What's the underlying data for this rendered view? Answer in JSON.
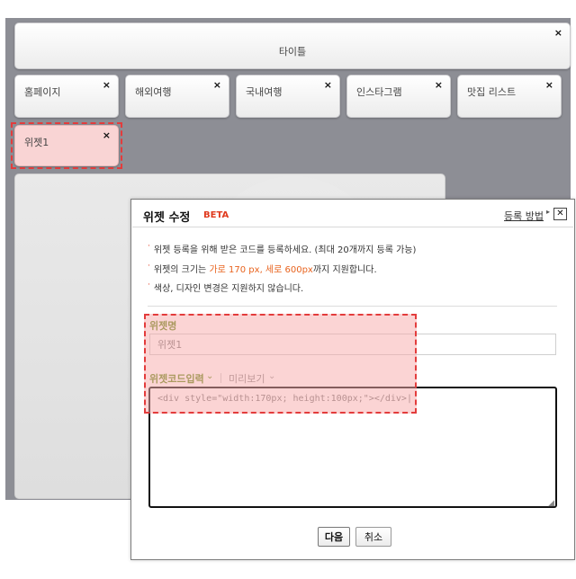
{
  "editor": {
    "title_tile": {
      "label": "타이틀",
      "close": "×"
    },
    "tabs": [
      {
        "label": "홈페이지",
        "close": "×"
      },
      {
        "label": "해외여행",
        "close": "×"
      },
      {
        "label": "국내여행",
        "close": "×"
      },
      {
        "label": "인스타그램",
        "close": "×"
      },
      {
        "label": "맛집 리스트",
        "close": "×"
      }
    ],
    "widget_tile": {
      "label": "위젯1",
      "close": "×"
    }
  },
  "dialog": {
    "title": "위젯 수정",
    "beta": "BETA",
    "help_link": "등록 방법",
    "help_arrow": "▸",
    "close": "✕",
    "notes": [
      {
        "pre": "위젯 등록을 위해 받은 코드를 등록하세요. (최대 20개까지 등록 가능)"
      },
      {
        "pre": "위젯의 크기는 ",
        "accent1": "가로 170 px",
        "mid": ", ",
        "accent2": "세로 600px",
        "post": "까지 지원합니다."
      },
      {
        "pre": "색상, 디자인 변경은 지원하지 않습니다."
      }
    ],
    "bullet": "·",
    "name_label": "위젯명",
    "name_value": "위젯1",
    "code_tab": "위젯코드입력",
    "code_tab_chevron": "⌄",
    "preview_tab": "미리보기",
    "preview_tab_chevron": "⌄",
    "code_value": "<div style=\"width:170px; height:100px;\"></div>|",
    "next_button": "다음",
    "cancel_button": "취소"
  },
  "colors": {
    "editor_bg": "#8d8e95",
    "highlight_border": "#e33c3c",
    "label_green": "#5f8b17",
    "accent_orange": "#e8631e",
    "beta_red": "#e03a1e"
  }
}
